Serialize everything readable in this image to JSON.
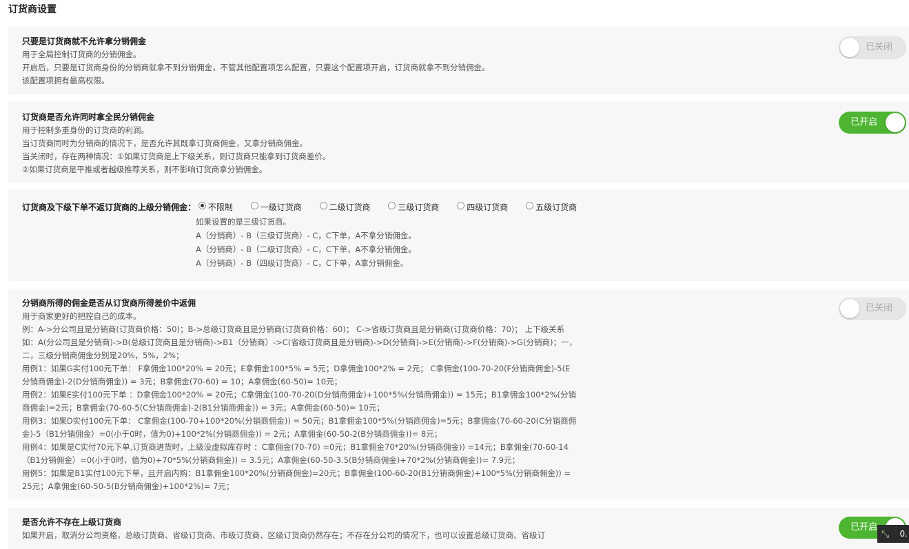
{
  "page": {
    "title": "订货商设置"
  },
  "colors": {
    "toggle_on": "#4db531",
    "toggle_off": "#e6e6e6",
    "card_bg": "#f7f7f7"
  },
  "section1": {
    "title": "只要是订货商就不允许拿分销佣金",
    "lines": [
      "用于全局控制订货商的分销佣金。",
      "开启后，只要是订货商身份的分销商就拿不到分销佣金，不管其他配置项怎么配置，只要这个配置项开启，订货商就拿不到分销佣金。",
      "该配置项拥有最高权限。"
    ],
    "toggle": "已关闭"
  },
  "section2": {
    "title": "订货商是否允许同时拿全民分销佣金",
    "lines": [
      "用于控制多重身份的订货商的利润。",
      "当订货商同时为分销商的情况下，是否允许其既拿订货商佣金，又拿分销商佣金。",
      "当关闭时，存在两种情况：①如果订货商是上下级关系，则订货商只能拿到订货商差价。",
      "②如果订货商是平推或者越级推荐关系，则不影响订货商拿分销佣金。"
    ],
    "toggle": "已开启"
  },
  "section3": {
    "label": "订货商及下级下单不返订货商的上级分销佣金：",
    "options": [
      "不限制",
      "一级订货商",
      "二级订货商",
      "三级订货商",
      "四级订货商",
      "五级订货商"
    ],
    "selected": "不限制",
    "notes": [
      "如果设置的是三级订货商。",
      "A（分销商）- B（三级订货商）- C，C下单，A不拿分销佣金。",
      "A（分销商）- B（二级订货商）- C，C下单，A不拿分销佣金。",
      "A（分销商）- B（四级订货商）- C，C下单，A拿分销佣金。"
    ]
  },
  "section4": {
    "title": "分销商所得的佣金是否从订货商所得差价中返佣",
    "intro": "用于商家更好的把控自己的成本。",
    "paragraphs": [
      "例：A->分公司且是分销商(订货商价格：50)；B->总级订货商且是分销商(订货商价格：60)； C->省级订货商且是分销商(订货商价格：70)； 上下级关系如：A(分公司且是分销商)->B(总级订货商且是分销商)->B1（分销商）->C(省级订货商且是分销商)->D(分销商)->E(分销商)->F(分销商)->G(分销商)；一，二，三级分销商佣金分别是20%，5%，2%；",
      "用例1：如果G实付100元下单： F拿佣金100*20% = 20元；E拿佣金100*5% = 5元；D拿佣金100*2% = 2元； C拿佣金(100-70-20(F分销商佣金)-5(E分销商佣金)-2(D分销商佣金)) = 3元；B拿佣金(70-60) = 10；A拿佣金(60-50)= 10元；",
      "用例2：如果E实付100元下单 ：D拿佣金100*20% = 20元；C拿佣金(100-70-20(D分销商佣金)+100*5%(分销商佣金)) = 15元；B1拿佣金100*2%(分销商佣金)=2元；B拿佣金(70-60-5(C分销商佣金)-2(B1分销商佣金)) = 3元；A拿佣金(60-50)= 10元；",
      "用例3：如果D实付100元下单： C拿佣金(100-70+100*20%(分销商佣金)) = 50元；B1拿佣金100*5%(分销商佣金)=5元；B拿佣金(70-60-20(C分销商佣金)-5（B1分销佣金）=0(小于0时，值为0)+100*2%(分销商佣金)) = 2元；A拿佣金(60-50-2(B分销商佣金))= 8元；",
      "用例4：如果是C实付70元下单,订货商进货时，上级没虚拟库存时 ：C拿佣金(70-70) =0元；B1拿佣金70*20%(分销商佣金)) =14元；B拿佣金(70-60-14（B1分销佣金）=0(小于0时，值为0)+70*5%(分销商佣金)) = 3.5元；A拿佣金(60-50-3.5(B分销商佣金)+70*2%(分销商佣金))= 7.9元；",
      "用例5：如果是B1实付100元下单，且开启内购：B1拿佣金100*20%(分销商佣金)=20元；B拿佣金(100-60-20(B1分销商佣金)+100*5%(分销商佣金)) = 25元；A拿佣金(60-50-5(B分销商佣金)+100*2%)= 7元；"
    ],
    "toggle": "已关闭"
  },
  "section5": {
    "title": "是否允许不存在上级订货商",
    "line": "如果开启，取消分公司资格，总级订货商、省级订货商、市级订货商、区级订货商仍然存在；不存在分公司的情况下，也可以设置总级订货商、省级订",
    "toggle": "已开启"
  },
  "corner": {
    "text": "0."
  }
}
